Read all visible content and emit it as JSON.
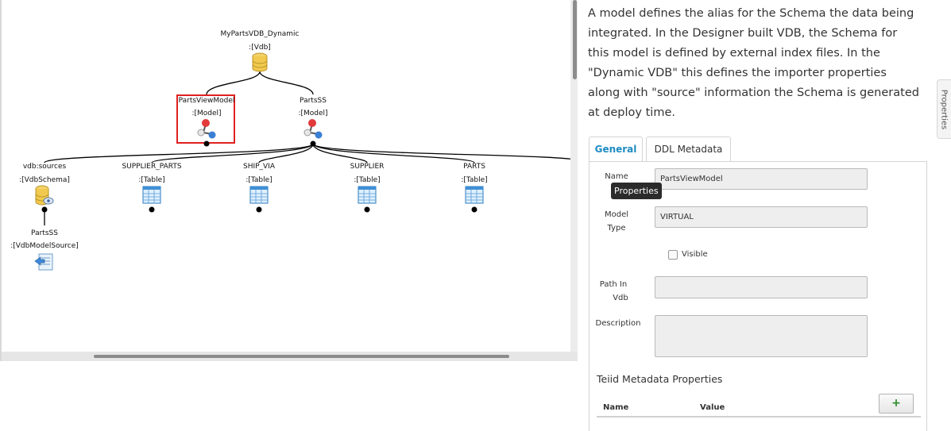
{
  "diagram": {
    "root": {
      "name": "MyPartsVDB_Dynamic",
      "type": ":[Vdb]"
    },
    "models": [
      {
        "name": "PartsViewModel",
        "type": ":[Model]",
        "selected": true
      },
      {
        "name": "PartsSS",
        "type": ":[Model]"
      }
    ],
    "children": [
      {
        "name": "vdb:sources",
        "type": ":[VdbSchema]"
      },
      {
        "name": "SUPPLIER_PARTS",
        "type": ":[Table]"
      },
      {
        "name": "SHIP_VIA",
        "type": ":[Table]"
      },
      {
        "name": "SUPPLIER",
        "type": ":[Table]"
      },
      {
        "name": "PARTS",
        "type": ":[Table]"
      }
    ],
    "source": {
      "name": "PartsSS",
      "type": ":[VdbModelSource]"
    }
  },
  "panel": {
    "description": "A model defines the alias for the Schema the data being integrated. In the Designer built VDB, the Schema for this model is defined by external index files. In the \"Dynamic VDB\" this defines the importer properties along with \"source\" information the Schema is generated at deploy time.",
    "tabs": [
      "General",
      "DDL Metadata"
    ],
    "active_tab": "General",
    "tooltip": "Properties",
    "fields": {
      "name_label": "Name",
      "name_value": "PartsViewModel",
      "model_type_label_1": "Model",
      "model_type_label_2": "Type",
      "model_type_value": "VIRTUAL",
      "visible_label": "Visible",
      "visible_checked": false,
      "path_label_1": "Path In",
      "path_label_2": "Vdb",
      "path_value": "",
      "description_label": "Description",
      "description_value": ""
    },
    "teiid": {
      "title": "Teiid Metadata Properties",
      "add_label": "+",
      "columns": [
        "Name",
        "Value"
      ]
    },
    "side_tab": "Properties"
  },
  "colors": {
    "accent": "#1e8bc3",
    "selection": "#e02020",
    "add": "#2a8a2a"
  },
  "icons": {
    "vdb": "database-icon",
    "model": "model-molecule-icon",
    "table": "table-icon",
    "schema": "database-schema-icon",
    "source": "model-source-icon"
  }
}
